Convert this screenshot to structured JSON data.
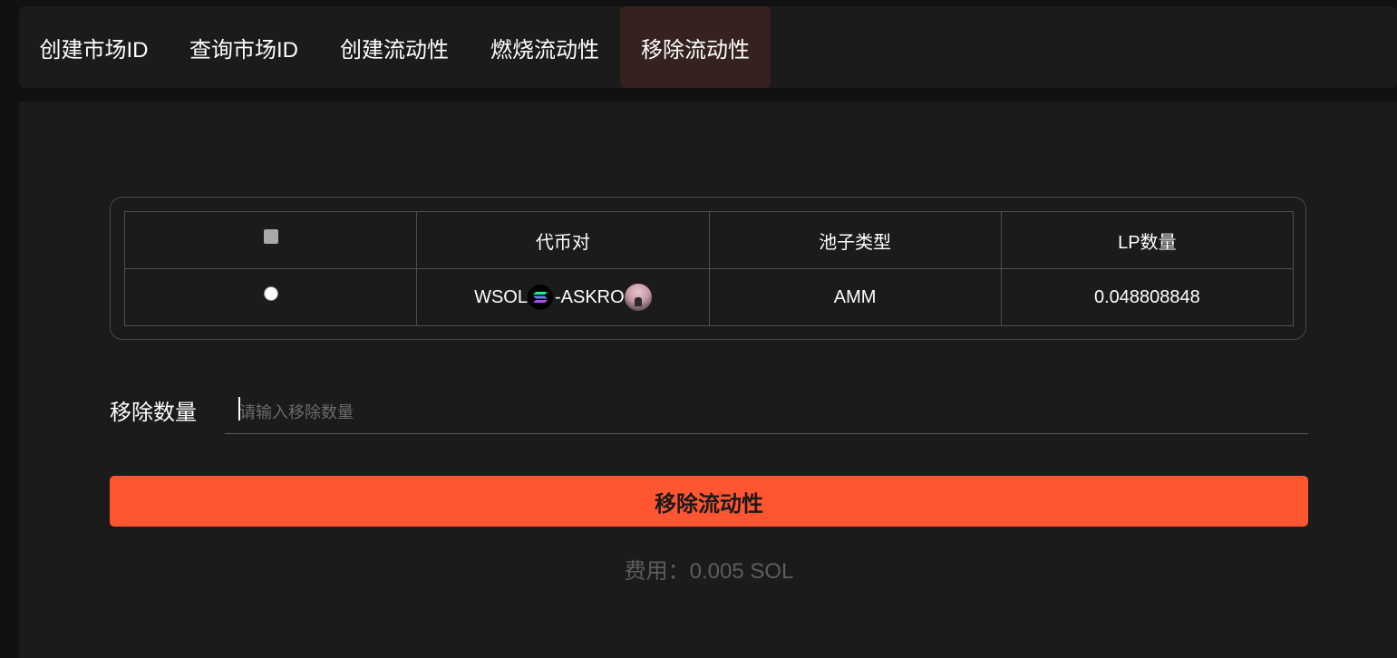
{
  "tabs": [
    {
      "label": "创建市场ID",
      "active": false
    },
    {
      "label": "查询市场ID",
      "active": false
    },
    {
      "label": "创建流动性",
      "active": false
    },
    {
      "label": "燃烧流动性",
      "active": false
    },
    {
      "label": "移除流动性",
      "active": true
    }
  ],
  "table": {
    "headers": {
      "select_all": "",
      "pair": "代币对",
      "pool_type": "池子类型",
      "lp_amount": "LP数量"
    },
    "rows": [
      {
        "token_a": "WSOL",
        "token_a_icon": "solana-icon",
        "separator": "- ",
        "token_b": "ASKRO",
        "token_b_icon": "askro-token-icon",
        "pool_type": "AMM",
        "lp_amount": "0.048808848",
        "selected": false
      }
    ]
  },
  "remove_amount": {
    "label": "移除数量",
    "placeholder": "请输入移除数量",
    "value": ""
  },
  "remove_button": {
    "label": "移除流动性"
  },
  "fee": {
    "text": "费用：0.005 SOL"
  },
  "colors": {
    "accent": "#ff5631",
    "active_tab_bg": "#35221f",
    "panel_bg": "#1b1b1b",
    "page_bg": "#111111"
  }
}
